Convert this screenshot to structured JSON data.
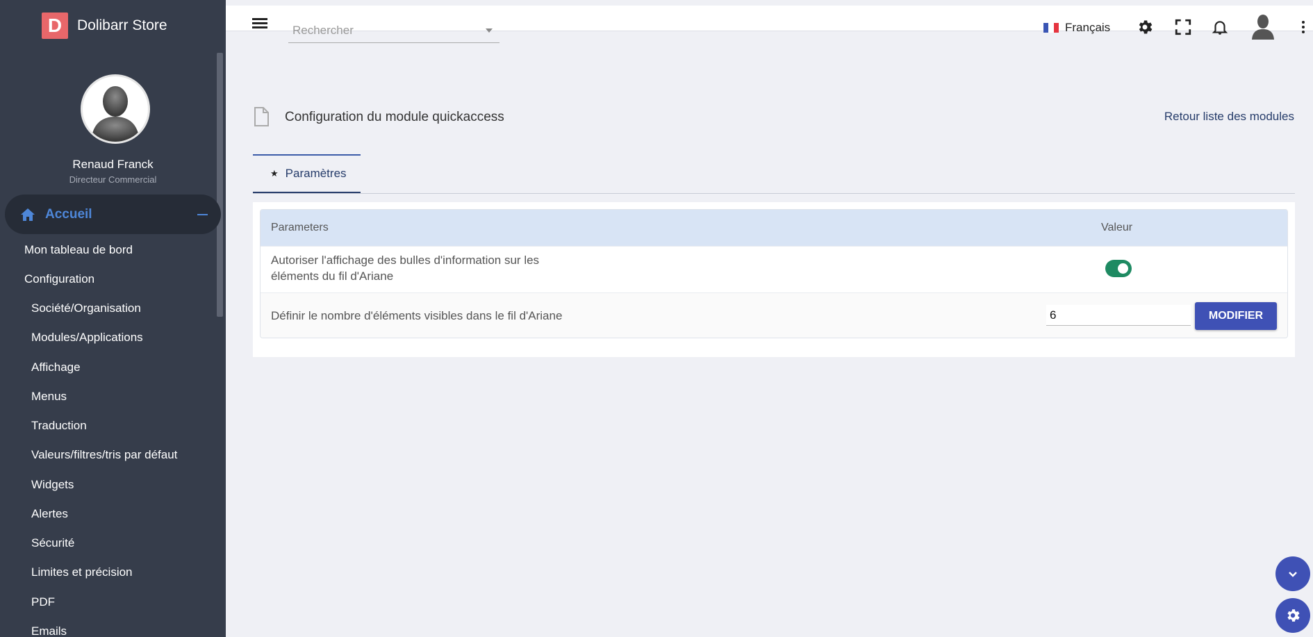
{
  "brand": {
    "logo_letter": "D",
    "name": "Dolibarr Store",
    "logo_color": "#e8676a"
  },
  "user": {
    "name": "Renaud Franck",
    "role": "Directeur Commercial"
  },
  "sidebar": {
    "home_label": "Accueil",
    "items": [
      {
        "label": "Mon tableau de bord",
        "level": 1
      },
      {
        "label": "Configuration",
        "level": 1
      },
      {
        "label": "Société/Organisation",
        "level": 2
      },
      {
        "label": "Modules/Applications",
        "level": 2
      },
      {
        "label": "Affichage",
        "level": 2
      },
      {
        "label": "Menus",
        "level": 2
      },
      {
        "label": "Traduction",
        "level": 2
      },
      {
        "label": "Valeurs/filtres/tris par défaut",
        "level": 2
      },
      {
        "label": "Widgets",
        "level": 2
      },
      {
        "label": "Alertes",
        "level": 2
      },
      {
        "label": "Sécurité",
        "level": 2
      },
      {
        "label": "Limites et précision",
        "level": 2
      },
      {
        "label": "PDF",
        "level": 2
      },
      {
        "label": "Emails",
        "level": 2
      }
    ]
  },
  "topbar": {
    "search_placeholder": "Rechercher",
    "language": "Français",
    "icons": [
      "menu-icon",
      "gear-icon",
      "fullscreen-icon",
      "bell-icon",
      "avatar",
      "kebab-icon"
    ]
  },
  "page": {
    "title": "Configuration du module quickaccess",
    "back_link": "Retour liste des modules"
  },
  "tabs": [
    {
      "label": "Paramètres",
      "icon": "star-icon",
      "active": true
    }
  ],
  "settings_table": {
    "headers": {
      "param": "Parameters",
      "value": "Valeur"
    },
    "rows": [
      {
        "line1": "Autoriser l'affichage des bulles d'information sur les",
        "line2": "éléments du fil d'Ariane",
        "type": "toggle",
        "enabled": true
      },
      {
        "label": "Définir le nombre d'éléments visibles dans le fil d'Ariane",
        "type": "number",
        "value": "6",
        "button_label": "MODIFIER"
      }
    ]
  },
  "colors": {
    "sidebar_bg": "#363d4b",
    "accent": "#3f51b5",
    "toggle_on": "#1e8a62",
    "home_accent": "#4e87d9"
  }
}
